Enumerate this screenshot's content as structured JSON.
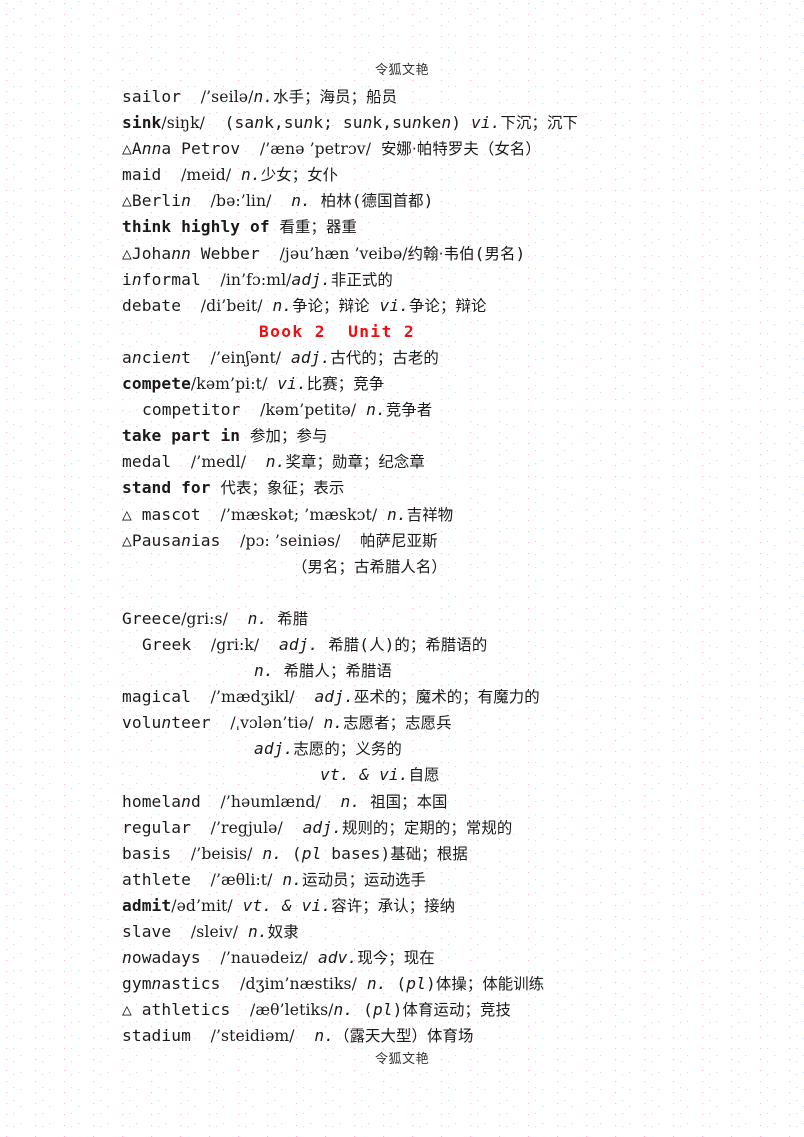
{
  "document": {
    "running_head_top": "令狐文艳",
    "running_head_bottom": "令狐文艳",
    "section_title": "Book 2  Unit 2",
    "section_title_color": "#e81010",
    "page_background": "#ffffff",
    "text_color": "#1a1a1a"
  },
  "entries": [
    {
      "id": "sailor",
      "indent": 0,
      "bold_headword": false,
      "headword": "sailor",
      "phonetic": "/’seilə/",
      "pos": "n.",
      "meaning": "水手；海员；船员",
      "line": "sailor  /’seilə/n.水手；海员；船员"
    },
    {
      "id": "sink",
      "indent": 0,
      "bold_headword": true,
      "headword": "sink",
      "phonetic": "/siŋk/",
      "forms": "(sank,sunk; sunk,sunken)",
      "pos": "vi.",
      "meaning": "下沉；沉下",
      "line": "sink/siŋk/  (sank,sunk; sunk,sunken) vi.下沉；沉下"
    },
    {
      "id": "anna-petrov",
      "indent": 0,
      "marker": "△",
      "bold_headword": false,
      "headword": "Anna Petrov",
      "phonetic": "/’ænə ’petrɔv/",
      "pos": "",
      "meaning": "安娜·帕特罗夫（女名）",
      "line": "△Anna Petrov  /’ænə ’petrɔv/ 安娜·帕特罗夫（女名）"
    },
    {
      "id": "maid",
      "indent": 0,
      "bold_headword": false,
      "headword": "maid",
      "phonetic": "/meid/",
      "pos": "n.",
      "meaning": "少女；女仆",
      "line": "maid  /meid/ n.少女；女仆"
    },
    {
      "id": "berlin",
      "indent": 0,
      "marker": "△",
      "bold_headword": false,
      "headword": "Berlin",
      "phonetic": "/bə:’lin/",
      "pos": "n.",
      "meaning": "柏林(德国首都)",
      "line": "△Berlin  /bə:’lin/  n. 柏林(德国首都)"
    },
    {
      "id": "think-highly-of",
      "indent": 0,
      "bold_headword": true,
      "headword": "think highly of",
      "phonetic": "",
      "pos": "",
      "meaning": "看重；器重",
      "line": "think highly of 看重；器重"
    },
    {
      "id": "johann-webber",
      "indent": 0,
      "marker": "△",
      "bold_headword": false,
      "headword": "Johann Webber",
      "phonetic": "/jəu’hæn ’veibə/",
      "pos": "",
      "meaning": "约翰·韦伯(男名)",
      "line": "△Johann Webber  /jəu’hæn ’veibə/约翰·韦伯(男名)"
    },
    {
      "id": "informal",
      "indent": 0,
      "bold_headword": false,
      "headword": "informal",
      "phonetic": "/in’fɔ:ml/",
      "pos": "adj.",
      "meaning": "非正式的",
      "line": "informal  /in’fɔ:ml/adj.非正式的"
    },
    {
      "id": "debate",
      "indent": 0,
      "bold_headword": false,
      "headword": "debate",
      "phonetic": "/di’beit/",
      "pos": "n. / vi.",
      "meaning": "争论；辩论 vi.争论；辩论",
      "line": "debate  /di’beit/ n.争论；辩论 vi.争论；辩论"
    },
    {
      "id": "ancient",
      "indent": 0,
      "bold_headword": false,
      "headword": "ancient",
      "phonetic": "/’einʃənt/",
      "pos": "adj.",
      "meaning": "古代的；古老的",
      "line": "ancient  /’einʃənt/ adj.古代的；古老的"
    },
    {
      "id": "compete",
      "indent": 0,
      "bold_headword": true,
      "headword": "compete",
      "phonetic": "/kəm’pi:t/",
      "pos": "vi.",
      "meaning": "比赛；竞争",
      "line": "compete/kəm’pi:t/ vi.比赛；竞争"
    },
    {
      "id": "competitor",
      "indent": 1,
      "bold_headword": false,
      "headword": "competitor",
      "phonetic": "/kəm’petitə/",
      "pos": "n.",
      "meaning": "竞争者",
      "line": "competitor  /kəm’petitə/ n.竞争者"
    },
    {
      "id": "take-part-in",
      "indent": 0,
      "bold_headword": true,
      "headword": "take part in",
      "phonetic": "",
      "pos": "",
      "meaning": "参加；参与",
      "line": "take part in 参加；参与"
    },
    {
      "id": "medal",
      "indent": 0,
      "bold_headword": false,
      "headword": "medal",
      "phonetic": "/’medl/",
      "pos": "n.",
      "meaning": "奖章；勋章；纪念章",
      "line": "medal  /’medl/  n.奖章；勋章；纪念章"
    },
    {
      "id": "stand-for",
      "indent": 0,
      "bold_headword": true,
      "headword": "stand for",
      "phonetic": "",
      "pos": "",
      "meaning": "代表；象征；表示",
      "line": "stand for 代表；象征；表示"
    },
    {
      "id": "mascot",
      "indent": 0,
      "marker": "△",
      "bold_headword": false,
      "headword": "mascot",
      "phonetic": "/’mæskət; ’mæskɔt/",
      "pos": "n.",
      "meaning": "吉祥物",
      "line": "△ mascot  /’mæskət; ’mæskɔt/ n.吉祥物"
    },
    {
      "id": "pausanias",
      "indent": 0,
      "marker": "△",
      "bold_headword": false,
      "headword": "Pausanias",
      "phonetic": "/pɔ: ’seiniəs/",
      "pos": "",
      "meaning": "帕萨尼亚斯",
      "line": "△Pausanias  /pɔ: ’seiniəs/  帕萨尼亚斯"
    },
    {
      "id": "pausanias-cont",
      "indent": 2,
      "continuation": true,
      "line": "（男名；古希腊人名）"
    },
    {
      "id": "blank-1",
      "indent": 0,
      "blank": true,
      "line": " "
    },
    {
      "id": "greece",
      "indent": 0,
      "bold_headword": false,
      "headword": "Greece",
      "phonetic": "/gri:s/",
      "pos": "n.",
      "meaning": "希腊",
      "line": "Greece/gri:s/  n. 希腊"
    },
    {
      "id": "greek",
      "indent": 1,
      "bold_headword": false,
      "headword": "Greek",
      "phonetic": "/gri:k/",
      "pos": "adj.",
      "meaning": "希腊(人)的；希腊语的",
      "line": "Greek  /gri:k/  adj. 希腊(人)的；希腊语的"
    },
    {
      "id": "greek-cont",
      "indent": 3,
      "continuation": true,
      "line": "n. 希腊人；希腊语"
    },
    {
      "id": "magical",
      "indent": 0,
      "bold_headword": false,
      "headword": "magical",
      "phonetic": "/’mædʒikl/",
      "pos": "adj.",
      "meaning": "巫术的；魔术的；有魔力的",
      "line": "magical  /’mædʒikl/  adj.巫术的；魔术的；有魔力的"
    },
    {
      "id": "volunteer",
      "indent": 0,
      "bold_headword": false,
      "headword": "volunteer",
      "phonetic": "/ˌvɔlən’tiə/",
      "pos": "n.",
      "meaning": "志愿者；志愿兵",
      "line": "volunteer  /ˌvɔlən’tiə/ n.志愿者；志愿兵"
    },
    {
      "id": "volunteer-adj",
      "indent": 3,
      "continuation": true,
      "line": "adj.志愿的；义务的"
    },
    {
      "id": "volunteer-vt",
      "indent": 4,
      "continuation": true,
      "line": "vt. & vi.自愿"
    },
    {
      "id": "homeland",
      "indent": 0,
      "bold_headword": false,
      "headword": "homeland",
      "phonetic": "/’həumlænd/",
      "pos": "n.",
      "meaning": "祖国；本国",
      "line": "homeland  /’həumlænd/  n. 祖国；本国"
    },
    {
      "id": "regular",
      "indent": 0,
      "bold_headword": false,
      "headword": "regular",
      "phonetic": "/’regjulə/",
      "pos": "adj.",
      "meaning": "规则的；定期的；常规的",
      "line": "regular  /’regjulə/  adj.规则的；定期的；常规的"
    },
    {
      "id": "basis",
      "indent": 0,
      "bold_headword": false,
      "headword": "basis",
      "phonetic": "/’beisis/",
      "pos": "n. (pl bases)",
      "meaning": "基础；根据",
      "line": "basis  /’beisis/ n. (pl bases)基础；根据"
    },
    {
      "id": "athlete",
      "indent": 0,
      "bold_headword": false,
      "headword": "athlete",
      "phonetic": "/’æθli:t/",
      "pos": "n.",
      "meaning": "运动员；运动选手",
      "line": "athlete  /’æθli:t/ n.运动员；运动选手"
    },
    {
      "id": "admit",
      "indent": 0,
      "bold_headword": true,
      "headword": "admit",
      "phonetic": "/əd’mit/",
      "pos": "vt. & vi.",
      "meaning": "容许；承认；接纳",
      "line": "admit/əd’mit/ vt. & vi.容许；承认；接纳"
    },
    {
      "id": "slave",
      "indent": 0,
      "bold_headword": false,
      "headword": "slave",
      "phonetic": "/sleiv/",
      "pos": "n.",
      "meaning": "奴隶",
      "line": "slave  /sleiv/ n.奴隶"
    },
    {
      "id": "nowadays",
      "indent": 0,
      "bold_headword": false,
      "headword": "nowadays",
      "phonetic": "/’nauədeiz/",
      "pos": "adv.",
      "meaning": "现今；现在",
      "line": "nowadays  /’nauədeiz/ adv.现今；现在"
    },
    {
      "id": "gymnastics",
      "indent": 0,
      "bold_headword": false,
      "headword": "gymnastics",
      "phonetic": "/dʒim’næstiks/",
      "pos": "n. (pl)",
      "meaning": "体操；体能训练",
      "line": "gymnastics  /dʒim’næstiks/ n. (pl)体操；体能训练"
    },
    {
      "id": "athletics",
      "indent": 0,
      "marker": "△",
      "bold_headword": false,
      "headword": "athletics",
      "phonetic": "/æθ’letiks/",
      "pos": "n. (pl)",
      "meaning": "体育运动；竞技",
      "line": "△ athletics  /æθ’letiks/n. (pl)体育运动；竞技"
    },
    {
      "id": "stadium",
      "indent": 0,
      "bold_headword": false,
      "headword": "stadium",
      "phonetic": "/’steidiəm/",
      "pos": "n.",
      "meaning": "（露天大型）体育场",
      "line": "stadium  /’steidiəm/  n.（露天大型）体育场"
    }
  ]
}
